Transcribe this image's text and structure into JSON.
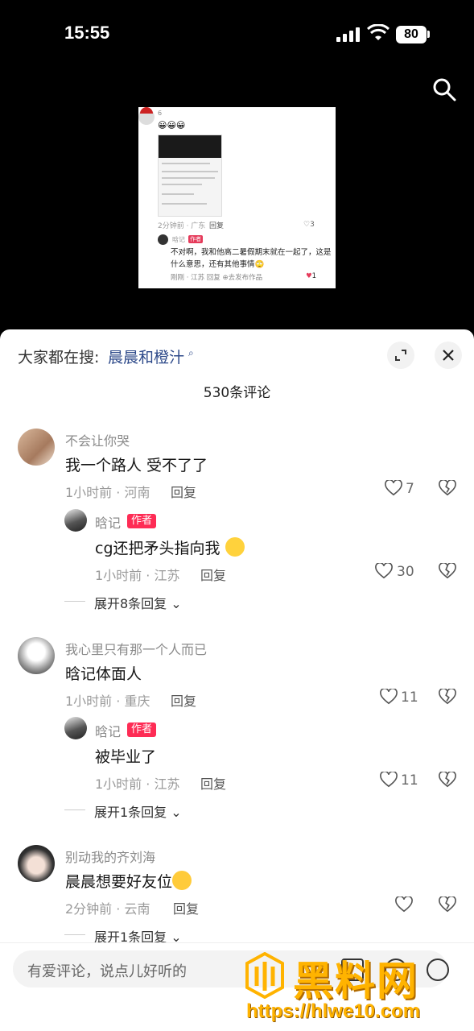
{
  "status": {
    "time": "15:55",
    "battery": "80"
  },
  "preview": {
    "name": "6",
    "emoji": "😀😀😀",
    "meta": "2分钟前 · 广东",
    "reply": "回复",
    "likes": "3",
    "reply_user": "晗记",
    "author_badge": "作者",
    "reply_text": "不对啊，我和他高二暑假期末就在一起了，这是什么意思，还有其他事情🙄",
    "reply_meta": "刚刚 · 江苏  回复  ⊕去发布作品",
    "reply_likes": "1"
  },
  "hot_search": {
    "label": "大家都在搜:",
    "term": "晨晨和橙汁"
  },
  "comment_count": "530条评论",
  "comments": [
    {
      "user": "不会让你哭",
      "text": "我一个路人 受不了了",
      "meta": "1小时前 · 河南",
      "reply": "回复",
      "likes": "7",
      "sub": {
        "user": "晗记",
        "badge": "作者",
        "text": "cg还把矛头指向我",
        "meta": "1小时前 · 江苏",
        "reply": "回复",
        "likes": "30"
      },
      "expand": "展开8条回复"
    },
    {
      "user": "我心里只有那一个人而已",
      "text": "晗记体面人",
      "meta": "1小时前 · 重庆",
      "reply": "回复",
      "likes": "11",
      "sub": {
        "user": "晗记",
        "badge": "作者",
        "text": "被毕业了",
        "meta": "1小时前 · 江苏",
        "reply": "回复",
        "likes": "11"
      },
      "expand": "展开1条回复"
    },
    {
      "user": "别动我的齐刘海",
      "text": "晨晨想要好友位",
      "meta": "2分钟前 · 云南",
      "reply": "回复",
      "likes": "",
      "expand": "展开1条回复"
    }
  ],
  "input": {
    "placeholder": "有爱评论，说点儿好听的"
  },
  "watermark": {
    "text": "黑料网",
    "url": "https://hlwe10.com"
  }
}
